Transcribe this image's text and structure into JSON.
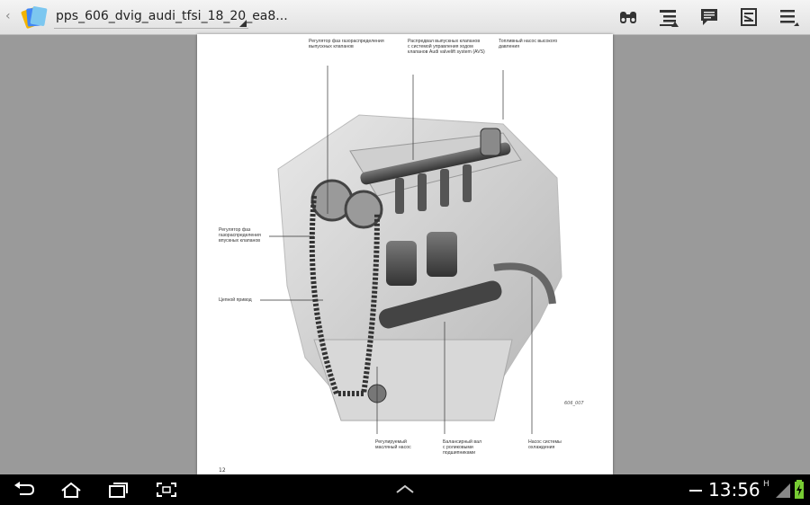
{
  "header": {
    "title": "pps_606_dvig_audi_tfsi_18_20_ea8...",
    "icons": [
      "back-chevron-icon",
      "app-logo-icon",
      "binoculars-icon",
      "outline-icon",
      "comment-icon",
      "highlight-icon",
      "menu-icon"
    ]
  },
  "document": {
    "labels": {
      "exhaust_phase": "Регулятор фаз газораспределения\nвыпускных клапанов",
      "exhaust_cam": "Распредвал выпускных клапанов\nс системой управления ходом\nклапанов Audi valvelift system (AVS)",
      "fuel_pump": "Топливный насос высокого\nдавления",
      "intake_phase": "Регулятор фаз\nгазораспределения\nвпускных клапанов",
      "chain_drive": "Цепной привод",
      "oil_pump": "Регулируемый\nмасляный насос",
      "balance_shaft": "Балансирный вал\nс роликовыми\nподшипниками",
      "coolant_pump": "Насос системы\nохлаждения"
    },
    "figure_code": "606_007",
    "page_number": "12"
  },
  "system_bar": {
    "time": "13:56",
    "status_h": "H",
    "icons": [
      "back-nav-icon",
      "home-nav-icon",
      "recent-apps-icon",
      "screenshot-icon",
      "up-chevron-icon",
      "signal-icon",
      "battery-icon"
    ]
  }
}
